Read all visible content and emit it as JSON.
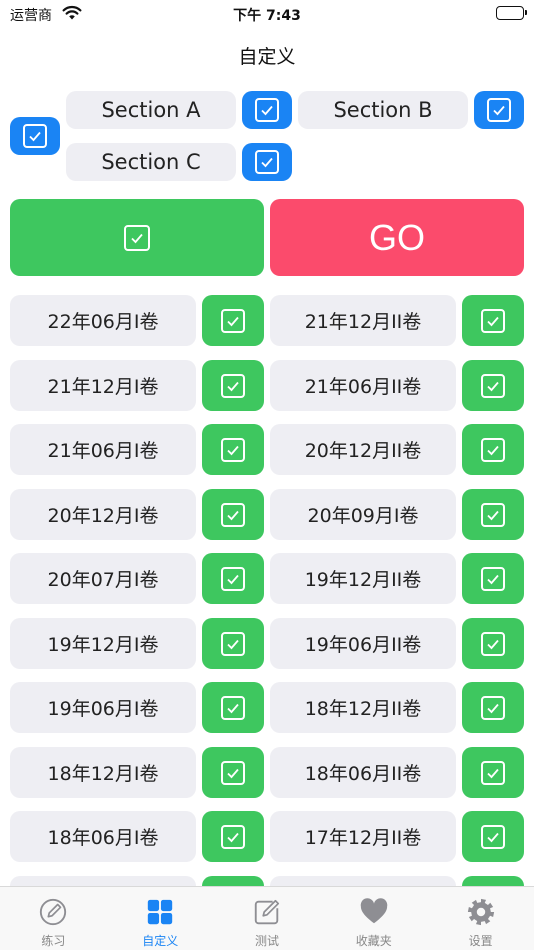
{
  "status_bar": {
    "carrier": "运营商",
    "time": "下午 7:43"
  },
  "nav": {
    "title": "自定义"
  },
  "sections": [
    {
      "label": "Section A",
      "checked": true
    },
    {
      "label": "Section B",
      "checked": true
    },
    {
      "label": "Section C",
      "checked": true
    }
  ],
  "select_all": {
    "checked": true
  },
  "actions": {
    "go_label": "GO"
  },
  "exams": [
    [
      "22年06月I卷",
      "21年12月II卷"
    ],
    [
      "21年12月I卷",
      "21年06月II卷"
    ],
    [
      "21年06月I卷",
      "20年12月II卷"
    ],
    [
      "20年12月I卷",
      "20年09月I卷"
    ],
    [
      "20年07月I卷",
      "19年12月II卷"
    ],
    [
      "19年12月I卷",
      "19年06月II卷"
    ],
    [
      "19年06月I卷",
      "18年12月II卷"
    ],
    [
      "18年12月I卷",
      "18年06月II卷"
    ],
    [
      "18年06月I卷",
      "17年12月II卷"
    ]
  ],
  "tabs": [
    {
      "label": "练习",
      "icon": "pencil-circle-icon",
      "active": false
    },
    {
      "label": "自定义",
      "icon": "grid-icon",
      "active": true
    },
    {
      "label": "测试",
      "icon": "edit-square-icon",
      "active": false
    },
    {
      "label": "收藏夹",
      "icon": "heart-icon",
      "active": false
    },
    {
      "label": "设置",
      "icon": "gear-icon",
      "active": false
    }
  ],
  "colors": {
    "blue": "#1a84f4",
    "green": "#3ec75f",
    "go": "#fb4b6c",
    "pill": "#eeeef3",
    "tab_inactive": "#8e8e93"
  }
}
